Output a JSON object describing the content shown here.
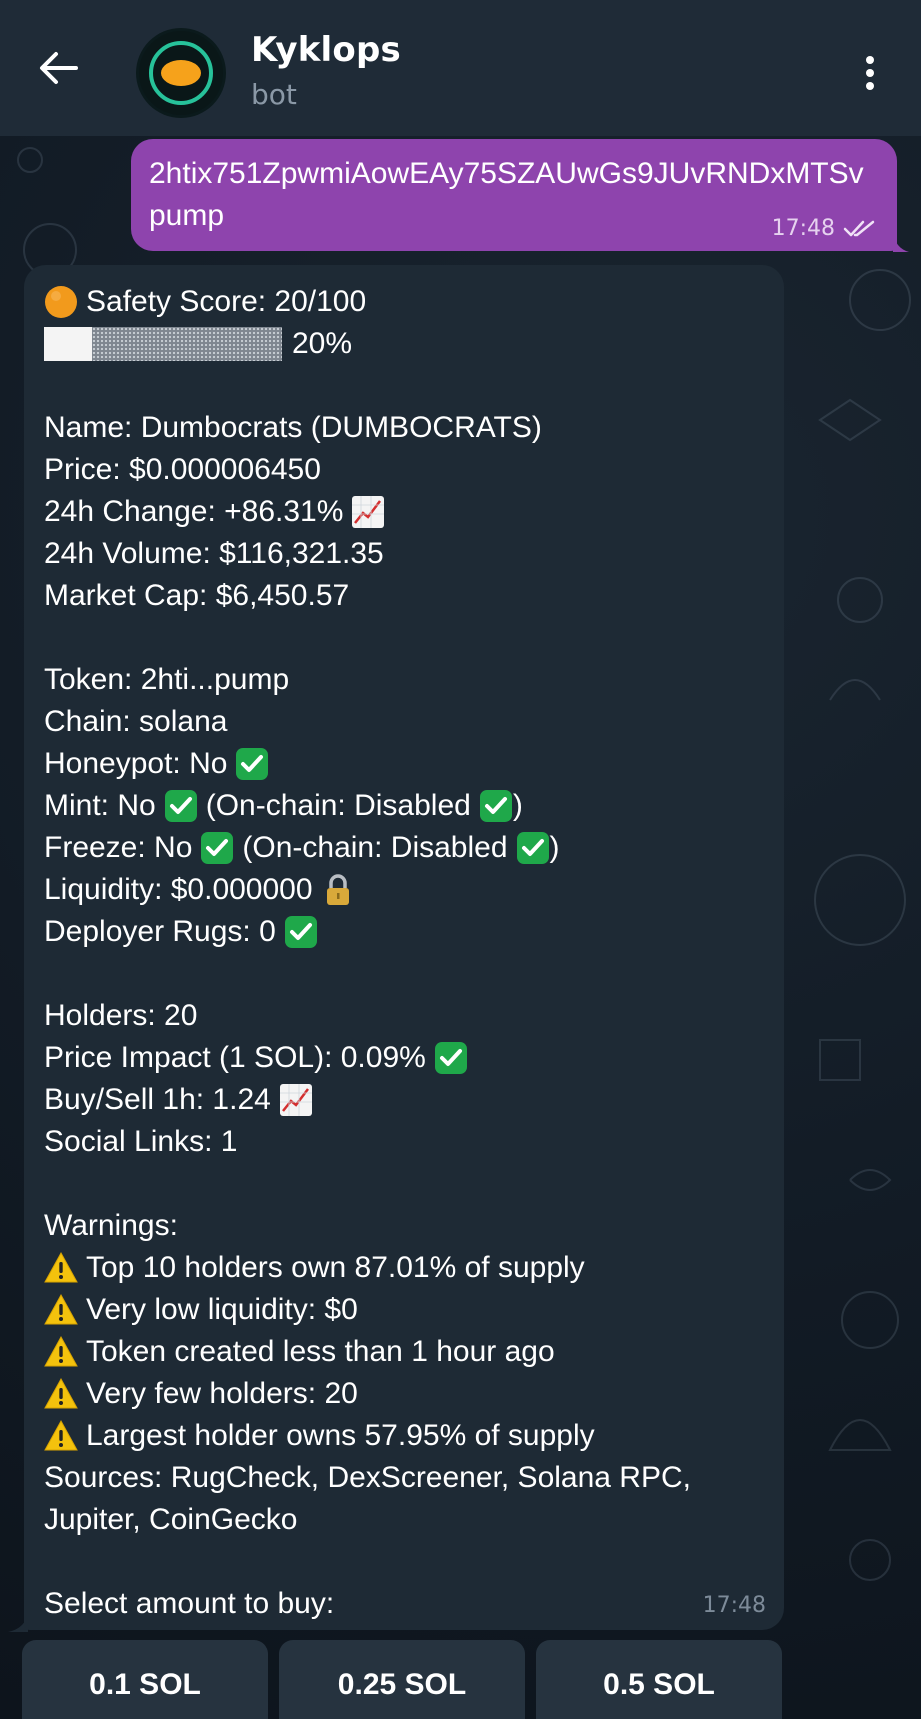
{
  "header": {
    "title": "Kyklops",
    "subtitle": "bot",
    "back_icon": "arrow-left-icon",
    "menu_icon": "more-vertical-icon"
  },
  "outgoing": {
    "text": "2htix751ZpwmiAowEAy75SZAUwGs9JUvRNDxMTSvpump",
    "time": "17:48",
    "status_icon": "double-check-icon"
  },
  "incoming": {
    "safety_score": "Safety Score: 20/100",
    "progress_label": "20%",
    "progress_value": 0.2,
    "name": "Name: Dumbocrats (DUMBOCRATS)",
    "price": "Price: $0.000006450",
    "change": "24h Change: +86.31%",
    "volume": "24h Volume: $116,321.35",
    "market_cap": "Market Cap: $6,450.57",
    "token": "Token: 2hti...pump",
    "chain": "Chain: solana",
    "honeypot": "Honeypot: No",
    "mint_a": "Mint: No",
    "mint_b": "(On-chain: Disabled",
    "freeze_a": "Freeze: No",
    "freeze_b": "(On-chain: Disabled",
    "close_paren": ")",
    "liquidity": "Liquidity: $0.000000",
    "deployer": "Deployer Rugs: 0",
    "holders": "Holders: 20",
    "price_impact": "Price Impact (1 SOL): 0.09%",
    "buy_sell": "Buy/Sell 1h: 1.24",
    "social": "Social Links: 1",
    "warnings_title": "Warnings:",
    "warnings": [
      "Top 10 holders own 87.01% of supply",
      "Very low liquidity: $0",
      "Token created less than 1 hour ago",
      "Very few holders: 20",
      "Largest holder owns 57.95% of supply"
    ],
    "sources_1": "Sources: RugCheck, DexScreener, Solana RPC,",
    "sources_2": "Jupiter, CoinGecko",
    "select_prompt": "Select amount to buy:",
    "time": "17:48"
  },
  "keyboard": [
    "0.1 SOL",
    "0.25 SOL",
    "0.5 SOL"
  ],
  "colors": {
    "header_bg": "#1f2b37",
    "outgoing_bubble": "#8e44ad",
    "incoming_bubble": "#1e2a35",
    "check_green": "#1fa84a",
    "warning_yellow": "#f4c20d",
    "score_orange": "#f29a1c"
  }
}
